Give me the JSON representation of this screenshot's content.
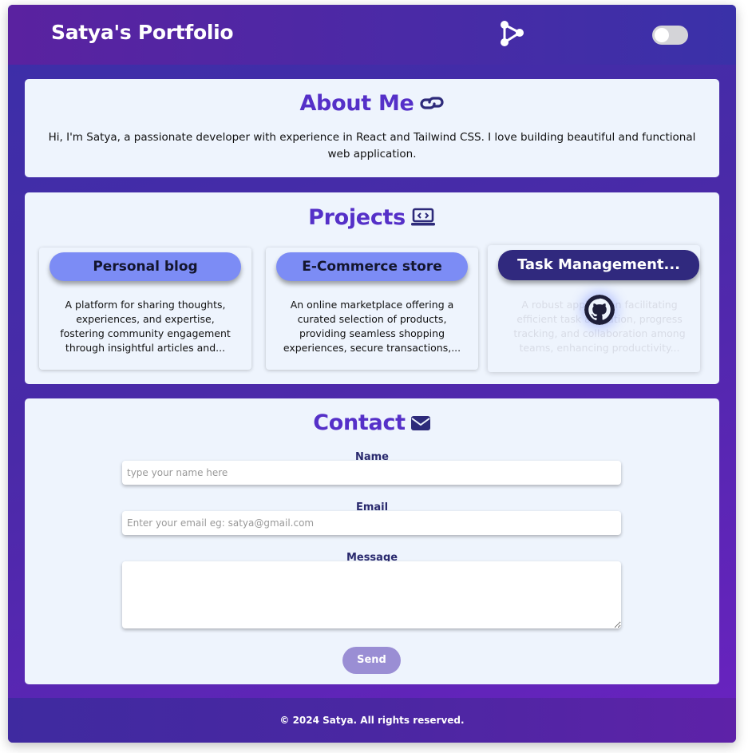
{
  "header": {
    "brand": "Satya's Portfolio",
    "share_icon": "share-nodes-icon",
    "theme_toggle": {
      "state": "off"
    }
  },
  "about": {
    "title": "About Me",
    "title_icon": "link-icon",
    "text": "Hi, I'm Satya, a passionate developer with experience in React and Tailwind CSS. I love building beautiful and functional web application."
  },
  "projects": {
    "title": "Projects",
    "title_icon": "laptop-code-icon",
    "items": [
      {
        "name": "Personal blog",
        "description": "A platform for sharing thoughts, experiences, and expertise, fostering community engagement through insightful articles and..."
      },
      {
        "name": "E-Commerce store",
        "description": "An online marketplace offering a curated selection of products, providing seamless shopping experiences, secure transactions,..."
      },
      {
        "name": "Task Management...",
        "description": "A robust application facilitating efficient task allocation, progress tracking, and collaboration among teams, enhancing productivity...",
        "hover_icon": "github-icon"
      }
    ]
  },
  "contact": {
    "title": "Contact",
    "title_icon": "envelope-icon",
    "name_label": "Name",
    "name_placeholder": "type your name here",
    "email_label": "Email",
    "email_placeholder": "Enter your email eg: satya@gmail.com",
    "message_label": "Message",
    "message_placeholder": "",
    "send_label": "Send"
  },
  "footer": {
    "text": "© 2024 Satya. All rights reserved."
  },
  "colors": {
    "accent": "#5530c8",
    "pill": "#7c8cf5",
    "pill_active": "#30297e",
    "send_button": "#9a8ed4",
    "card": "#eef4fd"
  }
}
